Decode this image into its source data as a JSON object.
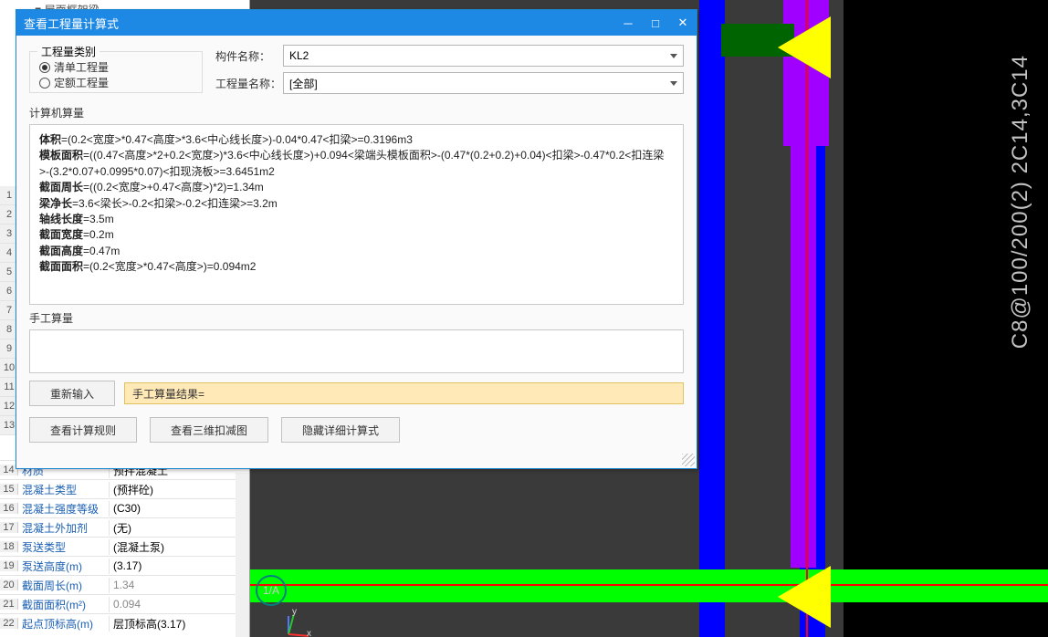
{
  "tree": {
    "item0": "屋面框架梁"
  },
  "dialog": {
    "title": "查看工程量计算式",
    "radio_legend": "工程量类别",
    "radio1": "清单工程量",
    "radio2": "定额工程量",
    "label_component": "构件名称：",
    "combo_component": "KL2",
    "label_qty": "工程量名称：",
    "combo_qty": "[全部]",
    "section_computer": "计算机算量",
    "calc_lines": [
      {
        "k": "体积",
        "v": "=(0.2<宽度>*0.47<高度>*3.6<中心线长度>)-0.04*0.47<扣梁>=0.3196m3"
      },
      {
        "k": "模板面积",
        "v": "=((0.47<高度>*2+0.2<宽度>)*3.6<中心线长度>)+0.094<梁端头模板面积>-(0.47*(0.2+0.2)+0.04)<扣梁>-0.47*0.2<扣连梁>-(3.2*0.07+0.0995*0.07)<扣现浇板>=3.6451m2"
      },
      {
        "k": "截面周长",
        "v": "=((0.2<宽度>+0.47<高度>)*2)=1.34m"
      },
      {
        "k": "梁净长",
        "v": "=3.6<梁长>-0.2<扣梁>-0.2<扣连梁>=3.2m"
      },
      {
        "k": "轴线长度",
        "v": "=3.5m"
      },
      {
        "k": "截面宽度",
        "v": "=0.2m"
      },
      {
        "k": "截面高度",
        "v": "=0.47m"
      },
      {
        "k": "截面面积",
        "v": "=(0.2<宽度>*0.47<高度>)=0.094m2"
      }
    ],
    "section_manual": "手工算量",
    "btn_reinput": "重新输入",
    "manual_result_prefix": "手工算量结果=",
    "btn_rule": "查看计算规则",
    "btn_3d": "查看三维扣减图",
    "btn_hide_detail": "隐藏详细计算式"
  },
  "props_numbers_top": [
    "1",
    "2",
    "3",
    "4",
    "5",
    "6",
    "7",
    "8",
    "9",
    "10",
    "11",
    "12",
    "13"
  ],
  "properties": [
    {
      "n": "14",
      "k": "材质",
      "v": "预拌混凝土",
      "kc": "blue",
      "vc": ""
    },
    {
      "n": "15",
      "k": "混凝土类型",
      "v": "(预拌砼)",
      "kc": "blue",
      "vc": ""
    },
    {
      "n": "16",
      "k": "混凝土强度等级",
      "v": "(C30)",
      "kc": "blue",
      "vc": ""
    },
    {
      "n": "17",
      "k": "混凝土外加剂",
      "v": "(无)",
      "kc": "blue",
      "vc": ""
    },
    {
      "n": "18",
      "k": "泵送类型",
      "v": "(混凝土泵)",
      "kc": "blue",
      "vc": ""
    },
    {
      "n": "19",
      "k": "泵送高度(m)",
      "v": "(3.17)",
      "kc": "blue",
      "vc": ""
    },
    {
      "n": "20",
      "k": "截面周长(m)",
      "v": "1.34",
      "kc": "blue",
      "vc": "gray"
    },
    {
      "n": "21",
      "k": "截面面积(m²)",
      "v": "0.094",
      "kc": "blue",
      "vc": "gray"
    },
    {
      "n": "22",
      "k": "起点顶标高(m)",
      "v": "层顶标高(3.17)",
      "kc": "blue",
      "vc": ""
    }
  ],
  "cad": {
    "vert_text": "C8@100/200(2) 2C14,3C14",
    "bubble": "1/A",
    "ucs_x": "x",
    "ucs_y": "y"
  }
}
